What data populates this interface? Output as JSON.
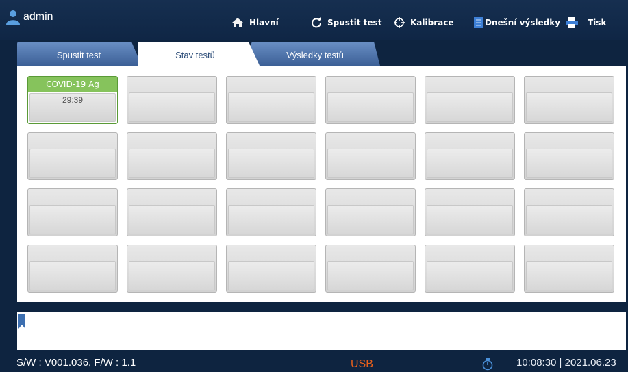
{
  "header": {
    "user": "admin",
    "nav": [
      {
        "label": "Hlavní",
        "icon": "home-icon"
      },
      {
        "label": "Spustit test",
        "icon": "refresh-icon"
      },
      {
        "label": "Kalibrace",
        "icon": "crosshair-icon"
      },
      {
        "label": "Dnešní výsledky",
        "icon": "document-icon"
      },
      {
        "label": "Tisk",
        "icon": "printer-icon"
      }
    ]
  },
  "tabs": [
    {
      "label": "Spustit test",
      "active": false
    },
    {
      "label": "Stav testů",
      "active": true
    },
    {
      "label": "Výsledky testů",
      "active": false
    }
  ],
  "grid": {
    "active_slot": {
      "name": "COVID-19 Ag",
      "time": "29:39"
    }
  },
  "status": {
    "version": "S/W : V001.036, F/W : 1.1",
    "usb": "USB",
    "datetime": "10:08:30 | 2021.06.23"
  },
  "colors": {
    "background": "#0e2440",
    "tab_blue": "#4a6fa5",
    "active_green": "#86c35c",
    "usb_orange": "#e8601c",
    "timer_blue": "#4a90d9"
  }
}
